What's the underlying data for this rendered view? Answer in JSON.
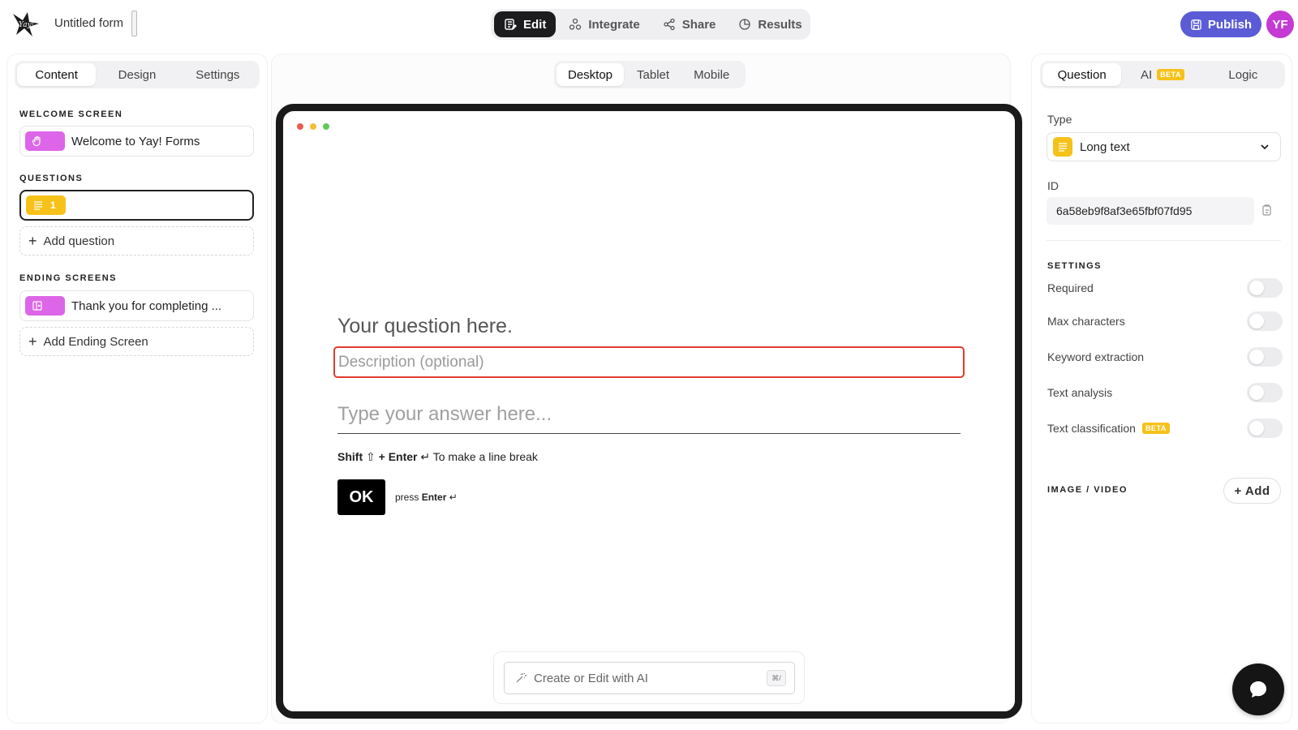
{
  "header": {
    "form_title": "Untitled form",
    "tabs": [
      {
        "label": "Edit",
        "icon": "edit-icon",
        "active": true
      },
      {
        "label": "Integrate",
        "icon": "integrate-icon",
        "active": false
      },
      {
        "label": "Share",
        "icon": "share-icon",
        "active": false
      },
      {
        "label": "Results",
        "icon": "results-icon",
        "active": false
      }
    ],
    "publish_label": "Publish",
    "avatar_initials": "YF",
    "avatar_color": "#c43ad3",
    "publish_color": "#5b5bd6"
  },
  "left": {
    "tabs": [
      {
        "label": "Content",
        "active": true
      },
      {
        "label": "Design",
        "active": false
      },
      {
        "label": "Settings",
        "active": false
      }
    ],
    "welcome_label": "WELCOME SCREEN",
    "welcome_item": "Welcome to Yay! Forms",
    "questions_label": "QUESTIONS",
    "questions": [
      {
        "number": "1",
        "text": "",
        "selected": true
      }
    ],
    "add_question": "Add question",
    "endings_label": "ENDING SCREENS",
    "ending_item": "Thank you for completing ...",
    "add_ending": "Add Ending Screen"
  },
  "center": {
    "devices": [
      {
        "label": "Desktop",
        "active": true
      },
      {
        "label": "Tablet",
        "active": false
      },
      {
        "label": "Mobile",
        "active": false
      }
    ],
    "question_placeholder": "Your question here.",
    "description_placeholder": "Description (optional)",
    "answer_placeholder": "Type your answer here...",
    "hint": {
      "shift": "Shift",
      "enter": "+ Enter",
      "rest": "To make a line break"
    },
    "ok_label": "OK",
    "press": "press",
    "press_enter": "Enter",
    "ai_placeholder": "Create or Edit with AI",
    "ai_shortcut": "⌘/",
    "window_dot_colors": [
      "#ec5b4f",
      "#f3be3c",
      "#62c85b"
    ]
  },
  "right": {
    "tabs": [
      {
        "label": "Question",
        "active": true
      },
      {
        "label": "AI",
        "badge": "BETA",
        "active": false
      },
      {
        "label": "Logic",
        "active": false
      }
    ],
    "type_label": "Type",
    "type_value": "Long text",
    "id_label": "ID",
    "id_value": "6a58eb9f8af3e65fbf07fd95",
    "settings_label": "SETTINGS",
    "settings": [
      {
        "label": "Required",
        "on": false
      },
      {
        "label": "Max characters",
        "on": false
      },
      {
        "label": "Keyword extraction",
        "on": false
      },
      {
        "label": "Text analysis",
        "on": false
      },
      {
        "label": "Text classification",
        "badge": "BETA",
        "on": false
      }
    ],
    "media_label": "IMAGE / VIDEO",
    "add_media": "+ Add"
  },
  "accent_yellow": "#f6c21a",
  "accent_pink": "#dd66e8",
  "highlight_red": "#e03c2f"
}
